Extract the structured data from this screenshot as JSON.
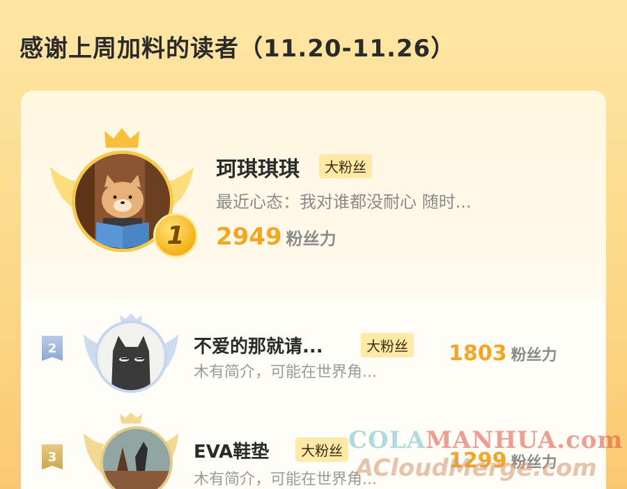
{
  "page_title": "感谢上周加料的读者（11.20-11.26）",
  "badge_label": "大粉丝",
  "score_unit": "粉丝力",
  "readers": [
    {
      "rank": "1",
      "name": "珂琪琪琪",
      "bio": "最近心态：我对谁都没耐心 随时...",
      "score": "2949",
      "avatar": "bear-reading-avatar"
    },
    {
      "rank": "2",
      "name": "不爱的那就请...",
      "bio": "木有简介，可能在世界角...",
      "score": "1803",
      "avatar": "black-cat-avatar"
    },
    {
      "rank": "3",
      "name": "EVA鞋垫",
      "bio": "木有简介，可能在世界角...",
      "score": "1299",
      "avatar": "landscape-figure-avatar"
    }
  ],
  "watermark": {
    "line1_a": "COLA",
    "line1_b": "MANHUA.com",
    "line2": "ACloudMerge.com"
  },
  "colors": {
    "gold": "#f2a623",
    "rank2": "#8ea9d2",
    "rank3": "#cba750"
  }
}
